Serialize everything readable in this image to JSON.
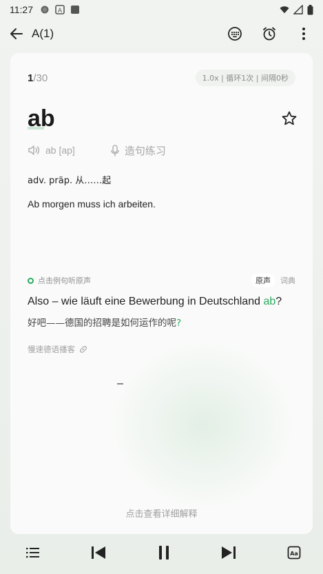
{
  "status_bar": {
    "time": "11:27",
    "left_icons": [
      "circle-icon",
      "text-a-icon",
      "app-square-icon"
    ],
    "right_icons": [
      "wifi-icon",
      "signal-icon",
      "battery-icon"
    ]
  },
  "app_bar": {
    "back_icon": "arrow-left-icon",
    "title": "A(1)",
    "actions": [
      "keyboard-icon",
      "alarm-clock-icon",
      "more-vert-icon"
    ]
  },
  "card": {
    "progress_current": "1",
    "progress_total": "/30",
    "play_settings": "1.0x | 循环1次 | 间隔0秒",
    "word": "ab",
    "pronunciation": "ab  [ap]",
    "practice_label": "造句练习",
    "definition": "adv. präp. 从……起",
    "example_sentence": "Ab morgen muss ich arbeiten.",
    "audio_hint": "点击例句听原声",
    "source_tabs": {
      "original": "原声",
      "dictionary": "词典"
    },
    "sentence_before": "Also – wie läuft eine Bewerbung in Deutschland ",
    "sentence_highlight": "ab",
    "sentence_after": "?",
    "translation_text": "好吧——德国的招聘是如何运作的呢",
    "translation_mark": "?",
    "podcast_source": "慢速德语播客",
    "detail_link": "点击查看详细解释"
  },
  "bottom_bar": {
    "icons": [
      "list-icon",
      "skip-previous-icon",
      "pause-icon",
      "skip-next-icon",
      "font-size-icon"
    ]
  },
  "colors": {
    "accent_green": "#2aab5e",
    "muted_text": "#a0a0a0",
    "background": "#eef1ee"
  }
}
